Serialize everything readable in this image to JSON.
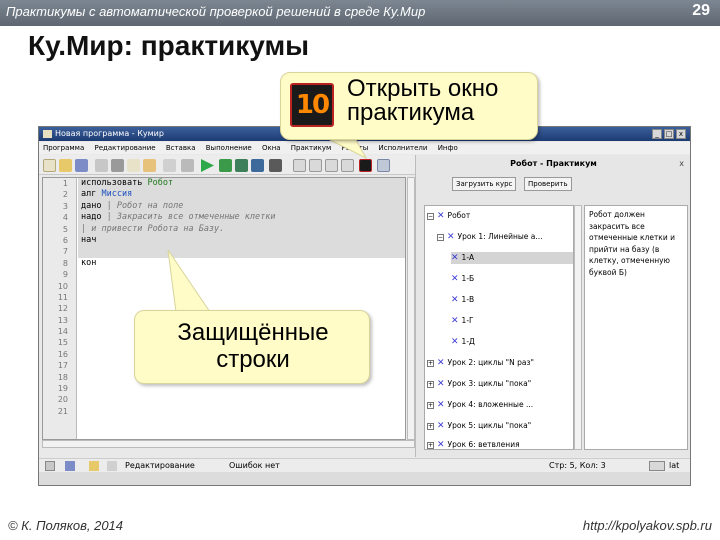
{
  "slide": {
    "subtitle": "Практикумы с автоматической проверкой решений в среде Ку.Мир",
    "page_number": "29",
    "title": "Ку.Мир: практикумы",
    "footer_left": "© К. Поляков, 2014",
    "footer_right": "http://kpolyakov.spb.ru"
  },
  "callouts": {
    "open_window_text_1": "Открыть окно",
    "open_window_text_2": "практикума",
    "open_icon_text": "10",
    "protected_text_1": "Защищённые",
    "protected_text_2": "строки"
  },
  "window": {
    "title": "Новая программа - Кумир",
    "menu": [
      "Программа",
      "Редактирование",
      "Вставка",
      "Выполнение",
      "Окна",
      "Практикум",
      "Роботы",
      "Исполнители",
      "Инфо"
    ],
    "pane": {
      "title": "Робот - Практикум",
      "close": "x",
      "load_label": "Загрузить курс",
      "check_label": "Проверить"
    },
    "line_numbers": [
      "1",
      "2",
      "3",
      "4",
      "5",
      "6",
      "7",
      "8",
      "9",
      "10",
      "11",
      "12",
      "13",
      "14",
      "15",
      "16",
      "17",
      "18",
      "19",
      "20",
      "21"
    ],
    "code": {
      "line1_kw": "использовать",
      "line1_name": "Робот",
      "line2_kw": "алг",
      "line2_name": "Миссия",
      "line3_kw": "дано",
      "line3_comment": "| Робот на поле",
      "line4_kw": "надо",
      "line4_comment": "| Закрасить все отмеченные клетки",
      "line5_comment": "| и привести Робота на Базу.",
      "line6_kw": "нач",
      "line8_kw": "кон"
    },
    "tree": [
      {
        "label": "Робот",
        "expand": "−",
        "level": 0
      },
      {
        "label": "Урок 1: Линейные а...",
        "expand": "−",
        "level": 1
      },
      {
        "label": "1-А",
        "expand": "",
        "level": 2,
        "selected": true
      },
      {
        "label": "1-Б",
        "expand": "",
        "level": 2
      },
      {
        "label": "1-В",
        "expand": "",
        "level": 2
      },
      {
        "label": "1-Г",
        "expand": "",
        "level": 2
      },
      {
        "label": "1-Д",
        "expand": "",
        "level": 2
      },
      {
        "label": "Урок 2: циклы \"N раз\"",
        "expand": "+",
        "level": 1
      },
      {
        "label": "Урок 3: циклы \"пока\"",
        "expand": "+",
        "level": 1
      },
      {
        "label": "Урок 4: вложенные ...",
        "expand": "+",
        "level": 1
      },
      {
        "label": "Урок 5: циклы \"пока\"",
        "expand": "+",
        "level": 1
      },
      {
        "label": "Урок 6: ветвления",
        "expand": "+",
        "level": 1
      }
    ],
    "description": "Робот должен закрасить все отмеченные клетки и прийти на базу (в клетку, отмеченную буквой Б)",
    "status": {
      "mode": "Редактирование",
      "errors": "Ошибок нет",
      "position": "Стр: 5, Кол: 3",
      "lang": "lat"
    }
  },
  "colors": {
    "callout_bg": "#fffcc8",
    "header_bg": "#6b7480",
    "keyword_green": "#1e7a1e",
    "keyword_blue": "#1a4fbf",
    "tree_mark": "#3b3bd6"
  }
}
